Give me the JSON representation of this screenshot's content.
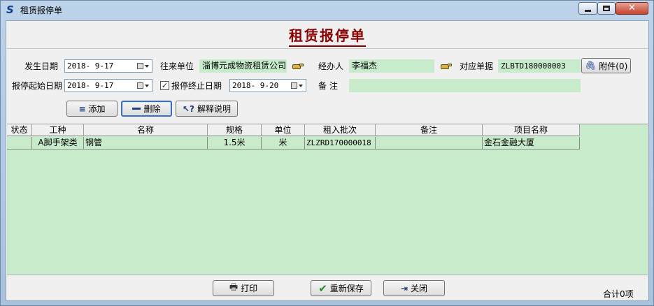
{
  "window": {
    "title": "租赁报停单",
    "icon": "app-s-logo-icon"
  },
  "form": {
    "title": "租赁报停单"
  },
  "fields": {
    "occur_date": {
      "label": "发生日期",
      "value": "2018- 9-17"
    },
    "partner": {
      "label": "往来单位",
      "value": "淄博元成物资租赁公司"
    },
    "handler": {
      "label": "经办人",
      "value": "李福杰"
    },
    "ref_doc": {
      "label": "对应单据",
      "value": "ZLBTD180000003"
    },
    "stop_start_date": {
      "label": "报停起始日期",
      "value": "2018- 9-17"
    },
    "stop_end_date": {
      "label": "报停终止日期",
      "value": "2018- 9-20",
      "checked": true
    },
    "remark": {
      "label": "备 注",
      "value": ""
    }
  },
  "buttons": {
    "attach": "附件(0)",
    "add": "添加",
    "delete": "删除",
    "explain": "解释说明",
    "print": "打印",
    "resave": "重新保存",
    "close": "关闭"
  },
  "grid": {
    "columns": [
      "状态",
      "工种",
      "名称",
      "规格",
      "单位",
      "租入批次",
      "备注",
      "项目名称"
    ],
    "rows": [
      [
        "",
        "A脚手架类",
        "钢管",
        "1.5米",
        "米",
        "ZLZRD170000018",
        "",
        "金石金融大厦"
      ]
    ]
  },
  "footer": {
    "total": "合计0项"
  },
  "colors": {
    "title_red": "#8b0000",
    "grid_green": "#c8ebcc",
    "window_blue": "#bcd3ea"
  }
}
